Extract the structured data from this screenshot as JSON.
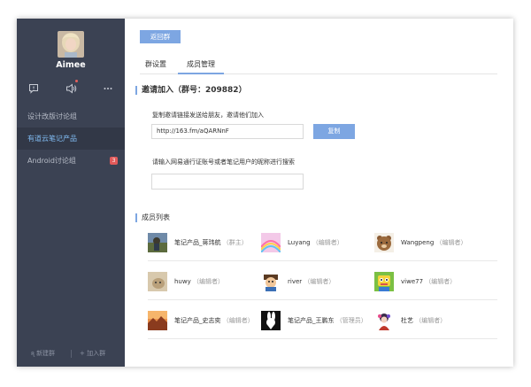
{
  "user": {
    "name": "Aimee"
  },
  "icons": {
    "chat": "chat-bubble-icon",
    "notice": "speaker-icon",
    "more": "more-dots-icon"
  },
  "groups": [
    {
      "label": "设计改版讨论组",
      "active": false,
      "badge": ""
    },
    {
      "label": "有道云笔记产品",
      "active": true,
      "badge": ""
    },
    {
      "label": "Android讨论组",
      "active": false,
      "badge": "3"
    }
  ],
  "footer": {
    "new_group": "新建群",
    "join_group": "加入群"
  },
  "main": {
    "back_label": "返回群",
    "tabs": [
      {
        "label": "群设置",
        "active": false
      },
      {
        "label": "成员管理",
        "active": true
      }
    ],
    "invite": {
      "title": "邀请加入（群号：209882）",
      "link_hint": "复制邀请链接发送给朋友，邀请他们加入",
      "link_value": "http://163.fm/aQARNnF",
      "copy_label": "复制",
      "search_hint": "请输入网易通行证账号或者笔记用户的昵称进行搜索",
      "search_value": ""
    },
    "members_title": "成员列表",
    "members": [
      {
        "name": "笔记产品_蒋玮航",
        "role": "（群主）",
        "avatar": "landscape"
      },
      {
        "name": "Luyang",
        "role": "（编辑者）",
        "avatar": "rainbow"
      },
      {
        "name": "Wangpeng",
        "role": "（编辑者）",
        "avatar": "bear"
      },
      {
        "name": "huwy",
        "role": "（编辑者）",
        "avatar": "cat"
      },
      {
        "name": "river",
        "role": "（编辑者）",
        "avatar": "cartoon"
      },
      {
        "name": "viwe77",
        "role": "（编辑者）",
        "avatar": "robot"
      },
      {
        "name": "笔记产品_史志奕",
        "role": "（编辑者）",
        "avatar": "sunset"
      },
      {
        "name": "笔记产品_王鹏东",
        "role": "（管理员）",
        "avatar": "bunny"
      },
      {
        "name": "杜艺",
        "role": "（编辑者）",
        "avatar": "doll"
      }
    ]
  },
  "colors": {
    "sidebar": "#3b4253",
    "accent": "#7da6e2",
    "badge": "#e25a5a"
  }
}
